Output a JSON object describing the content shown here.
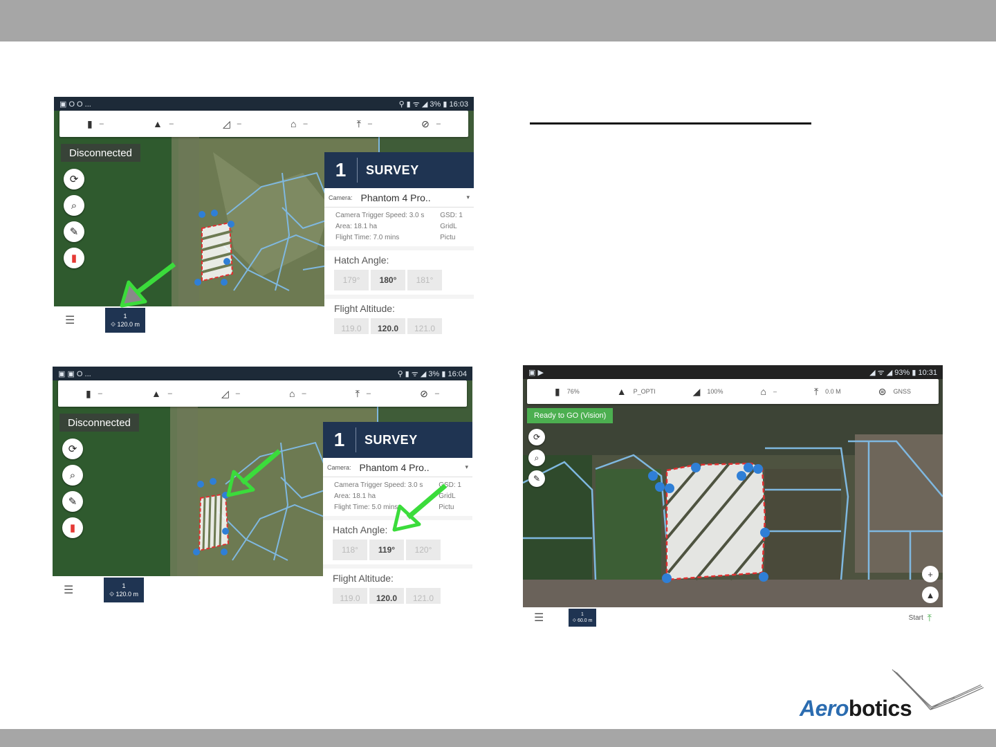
{
  "colors": {
    "accent_green": "#3bdc3b",
    "panel_navy": "#1f3452",
    "waypoint_blue": "#2f7fd6",
    "boundary_red": "#e03030",
    "field_line": "#7fb8e0"
  },
  "logo": {
    "prefix": "Aero",
    "suffix": "botics"
  },
  "screenshot_top": {
    "status": {
      "left": "▣ O O ...",
      "right": "⚲ ▮ ᯤ ◢ 3% ▮ 16:03"
    },
    "toolbar": [
      {
        "icon": "battery-icon",
        "glyph": "▮",
        "value": "–"
      },
      {
        "icon": "satellite-icon",
        "glyph": "▲",
        "value": "–"
      },
      {
        "icon": "signal-icon",
        "glyph": "◿",
        "value": "–"
      },
      {
        "icon": "home-icon",
        "glyph": "⌂",
        "value": "–"
      },
      {
        "icon": "altitude-icon",
        "glyph": "⤒",
        "value": "–"
      },
      {
        "icon": "speed-icon",
        "glyph": "⊘",
        "value": "–"
      }
    ],
    "connection": "Disconnected",
    "panel": {
      "number": "1",
      "title": "SURVEY",
      "camera_label": "Camera:",
      "camera_value": "Phantom 4 Pro..",
      "info_left": [
        "Camera Trigger Speed: 3.0 s",
        "Area: 18.1 ha",
        "Flight Time: 7.0 mins"
      ],
      "info_right": [
        "GSD: 1",
        "GridL",
        "Pictu"
      ],
      "hatch_label": "Hatch Angle:",
      "hatch_values": [
        "179°",
        "180°",
        "181°"
      ],
      "alt_label": "Flight Altitude:",
      "alt_values": [
        "119.0",
        "120.0",
        "121.0"
      ]
    },
    "chip": {
      "number": "1",
      "altitude": "⟐ 120.0 m"
    }
  },
  "screenshot_mid": {
    "status": {
      "left": "▣ ▣ O ...",
      "right": "⚲ ▮ ᯤ ◢ 3% ▮ 16:04"
    },
    "connection": "Disconnected",
    "panel": {
      "number": "1",
      "title": "SURVEY",
      "camera_label": "Camera:",
      "camera_value": "Phantom 4 Pro..",
      "info_left": [
        "Camera Trigger Speed: 3.0 s",
        "Area: 18.1 ha",
        "Flight Time: 5.0 mins"
      ],
      "info_right": [
        "GSD: 1",
        "GridL",
        "Pictu"
      ],
      "hatch_label": "Hatch Angle:",
      "hatch_values": [
        "118°",
        "119°",
        "120°"
      ],
      "alt_label": "Flight Altitude:",
      "alt_values": [
        "119.0",
        "120.0",
        "121.0"
      ]
    },
    "chip": {
      "number": "1",
      "altitude": "⟐ 120.0 m"
    }
  },
  "screenshot_right": {
    "status": {
      "left": "▣ ▶",
      "right": "◢ ᯤ ◢ 93% ▮ 10:31"
    },
    "toolbar": [
      {
        "icon": "battery-icon",
        "glyph": "▮",
        "value": "76%"
      },
      {
        "icon": "satellite-icon",
        "glyph": "▲",
        "value": "P_OPTI"
      },
      {
        "icon": "signal-icon",
        "glyph": "◢",
        "value": "100%"
      },
      {
        "icon": "home-icon",
        "glyph": "⌂",
        "value": "–"
      },
      {
        "icon": "altitude-icon",
        "glyph": "⤒",
        "value": "0.0 M"
      },
      {
        "icon": "drone-icon",
        "glyph": "⊜",
        "value": "GNSS"
      }
    ],
    "status_pill": "Ready to GO (Vision)",
    "chip": {
      "number": "1",
      "altitude": "⟐ 60.0 m"
    },
    "start": "Start"
  }
}
